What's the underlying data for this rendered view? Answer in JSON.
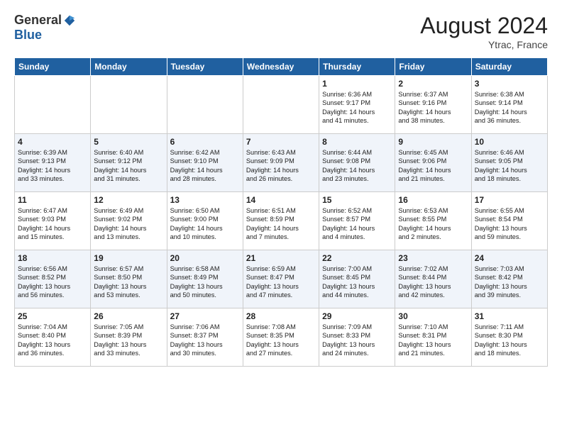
{
  "header": {
    "logo_general": "General",
    "logo_blue": "Blue",
    "month_year": "August 2024",
    "location": "Ytrac, France"
  },
  "weekdays": [
    "Sunday",
    "Monday",
    "Tuesday",
    "Wednesday",
    "Thursday",
    "Friday",
    "Saturday"
  ],
  "weeks": [
    [
      {
        "day": "",
        "info": ""
      },
      {
        "day": "",
        "info": ""
      },
      {
        "day": "",
        "info": ""
      },
      {
        "day": "",
        "info": ""
      },
      {
        "day": "1",
        "info": "Sunrise: 6:36 AM\nSunset: 9:17 PM\nDaylight: 14 hours\nand 41 minutes."
      },
      {
        "day": "2",
        "info": "Sunrise: 6:37 AM\nSunset: 9:16 PM\nDaylight: 14 hours\nand 38 minutes."
      },
      {
        "day": "3",
        "info": "Sunrise: 6:38 AM\nSunset: 9:14 PM\nDaylight: 14 hours\nand 36 minutes."
      }
    ],
    [
      {
        "day": "4",
        "info": "Sunrise: 6:39 AM\nSunset: 9:13 PM\nDaylight: 14 hours\nand 33 minutes."
      },
      {
        "day": "5",
        "info": "Sunrise: 6:40 AM\nSunset: 9:12 PM\nDaylight: 14 hours\nand 31 minutes."
      },
      {
        "day": "6",
        "info": "Sunrise: 6:42 AM\nSunset: 9:10 PM\nDaylight: 14 hours\nand 28 minutes."
      },
      {
        "day": "7",
        "info": "Sunrise: 6:43 AM\nSunset: 9:09 PM\nDaylight: 14 hours\nand 26 minutes."
      },
      {
        "day": "8",
        "info": "Sunrise: 6:44 AM\nSunset: 9:08 PM\nDaylight: 14 hours\nand 23 minutes."
      },
      {
        "day": "9",
        "info": "Sunrise: 6:45 AM\nSunset: 9:06 PM\nDaylight: 14 hours\nand 21 minutes."
      },
      {
        "day": "10",
        "info": "Sunrise: 6:46 AM\nSunset: 9:05 PM\nDaylight: 14 hours\nand 18 minutes."
      }
    ],
    [
      {
        "day": "11",
        "info": "Sunrise: 6:47 AM\nSunset: 9:03 PM\nDaylight: 14 hours\nand 15 minutes."
      },
      {
        "day": "12",
        "info": "Sunrise: 6:49 AM\nSunset: 9:02 PM\nDaylight: 14 hours\nand 13 minutes."
      },
      {
        "day": "13",
        "info": "Sunrise: 6:50 AM\nSunset: 9:00 PM\nDaylight: 14 hours\nand 10 minutes."
      },
      {
        "day": "14",
        "info": "Sunrise: 6:51 AM\nSunset: 8:59 PM\nDaylight: 14 hours\nand 7 minutes."
      },
      {
        "day": "15",
        "info": "Sunrise: 6:52 AM\nSunset: 8:57 PM\nDaylight: 14 hours\nand 4 minutes."
      },
      {
        "day": "16",
        "info": "Sunrise: 6:53 AM\nSunset: 8:55 PM\nDaylight: 14 hours\nand 2 minutes."
      },
      {
        "day": "17",
        "info": "Sunrise: 6:55 AM\nSunset: 8:54 PM\nDaylight: 13 hours\nand 59 minutes."
      }
    ],
    [
      {
        "day": "18",
        "info": "Sunrise: 6:56 AM\nSunset: 8:52 PM\nDaylight: 13 hours\nand 56 minutes."
      },
      {
        "day": "19",
        "info": "Sunrise: 6:57 AM\nSunset: 8:50 PM\nDaylight: 13 hours\nand 53 minutes."
      },
      {
        "day": "20",
        "info": "Sunrise: 6:58 AM\nSunset: 8:49 PM\nDaylight: 13 hours\nand 50 minutes."
      },
      {
        "day": "21",
        "info": "Sunrise: 6:59 AM\nSunset: 8:47 PM\nDaylight: 13 hours\nand 47 minutes."
      },
      {
        "day": "22",
        "info": "Sunrise: 7:00 AM\nSunset: 8:45 PM\nDaylight: 13 hours\nand 44 minutes."
      },
      {
        "day": "23",
        "info": "Sunrise: 7:02 AM\nSunset: 8:44 PM\nDaylight: 13 hours\nand 42 minutes."
      },
      {
        "day": "24",
        "info": "Sunrise: 7:03 AM\nSunset: 8:42 PM\nDaylight: 13 hours\nand 39 minutes."
      }
    ],
    [
      {
        "day": "25",
        "info": "Sunrise: 7:04 AM\nSunset: 8:40 PM\nDaylight: 13 hours\nand 36 minutes."
      },
      {
        "day": "26",
        "info": "Sunrise: 7:05 AM\nSunset: 8:39 PM\nDaylight: 13 hours\nand 33 minutes."
      },
      {
        "day": "27",
        "info": "Sunrise: 7:06 AM\nSunset: 8:37 PM\nDaylight: 13 hours\nand 30 minutes."
      },
      {
        "day": "28",
        "info": "Sunrise: 7:08 AM\nSunset: 8:35 PM\nDaylight: 13 hours\nand 27 minutes."
      },
      {
        "day": "29",
        "info": "Sunrise: 7:09 AM\nSunset: 8:33 PM\nDaylight: 13 hours\nand 24 minutes."
      },
      {
        "day": "30",
        "info": "Sunrise: 7:10 AM\nSunset: 8:31 PM\nDaylight: 13 hours\nand 21 minutes."
      },
      {
        "day": "31",
        "info": "Sunrise: 7:11 AM\nSunset: 8:30 PM\nDaylight: 13 hours\nand 18 minutes."
      }
    ]
  ]
}
